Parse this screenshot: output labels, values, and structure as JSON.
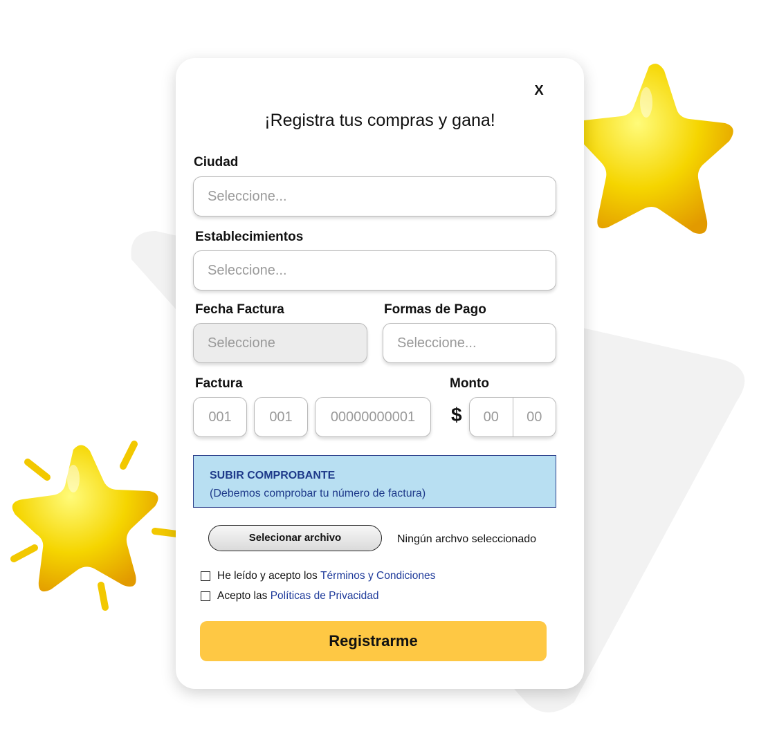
{
  "form": {
    "close_label": "X",
    "title": "¡Registra tus compras y gana!",
    "ciudad": {
      "label": "Ciudad",
      "placeholder": "Seleccione..."
    },
    "establecimientos": {
      "label": "Establecimientos",
      "placeholder": "Seleccione..."
    },
    "fecha_factura": {
      "label": "Fecha Factura",
      "placeholder": "Seleccione"
    },
    "formas_pago": {
      "label": "Formas de Pago",
      "placeholder": "Seleccione..."
    },
    "factura": {
      "label": "Factura",
      "part1": "001",
      "part2": "001",
      "part3": "00000000001"
    },
    "monto": {
      "label": "Monto",
      "currency": "$",
      "integer_placeholder": "00",
      "cents_placeholder": "00"
    },
    "upload": {
      "title": "SUBIR COMPROBANTE",
      "subtitle": "(Debemos comprobar tu número de factura)",
      "button_label": "Selecionar archivo",
      "status": "Ningún archvo seleccionado"
    },
    "terms": {
      "prefix": "He leído y acepto los ",
      "link": "Términos y Condiciones",
      "checked": false
    },
    "privacy": {
      "prefix": "Acepto las ",
      "link": "Políticas de Privacidad",
      "checked": false
    },
    "submit_label": "Registrarme"
  },
  "colors": {
    "accent": "#fec844",
    "upload_bg": "#b8dff2",
    "link": "#1e3a9a",
    "star": "#f5d500"
  },
  "decorations": {
    "stars": [
      "star-icon",
      "star-icon"
    ]
  }
}
